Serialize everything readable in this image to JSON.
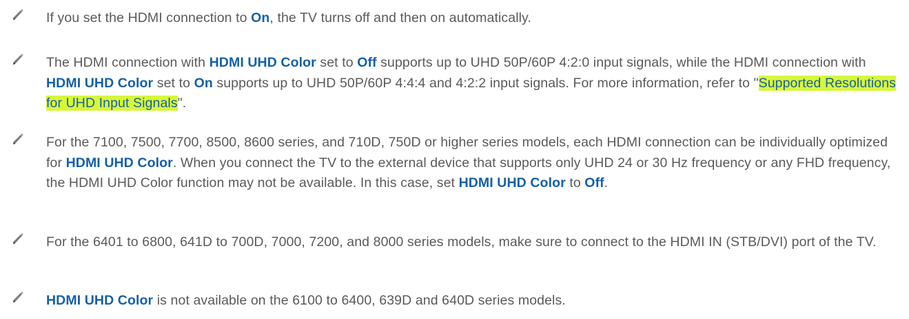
{
  "notes": [
    {
      "segments": [
        {
          "t": "If you set the HDMI connection to "
        },
        {
          "t": "On",
          "kw": true
        },
        {
          "t": ", the TV turns off and then on automatically."
        }
      ]
    },
    {
      "segments": [
        {
          "t": "The HDMI connection with "
        },
        {
          "t": "HDMI UHD Color",
          "kw": true
        },
        {
          "t": " set to "
        },
        {
          "t": "Off",
          "kw": true
        },
        {
          "t": " supports up to UHD 50P/60P 4:2:0 input signals, while the HDMI connection with "
        },
        {
          "t": "HDMI UHD Color",
          "kw": true
        },
        {
          "t": " set to "
        },
        {
          "t": "On",
          "kw": true
        },
        {
          "t": " supports up to UHD 50P/60P 4:4:4 and 4:2:2 input signals. For more information, refer to \""
        },
        {
          "t": "Supported Resolutions for UHD Input Signals",
          "link": true
        },
        {
          "t": "\"."
        }
      ]
    },
    {
      "segments": [
        {
          "t": "For the 7100, 7500, 7700, 8500, 8600 series, and 710D, 750D or higher series models, each HDMI connection can be individually optimized for "
        },
        {
          "t": "HDMI UHD Color",
          "kw": true
        },
        {
          "t": ". When you connect the TV to the external device that supports only UHD 24 or 30 Hz frequency or any FHD frequency, the HDMI UHD Color function may not be available. In this case, set "
        },
        {
          "t": "HDMI UHD Color",
          "kw": true
        },
        {
          "t": " to "
        },
        {
          "t": "Off",
          "kw": true
        },
        {
          "t": "."
        }
      ]
    },
    {
      "segments": [
        {
          "t": "For the 6401 to 6800, 641D to 700D, 7000, 7200, and 8000 series models, make sure to connect to the HDMI IN (STB/DVI) port of the TV."
        }
      ]
    },
    {
      "segments": [
        {
          "t": "HDMI UHD Color",
          "kw": true
        },
        {
          "t": " is not available on the 6100 to 6400, 639D and 640D series models."
        }
      ]
    }
  ],
  "colors": {
    "text": "#5a5a5a",
    "keyword": "#1560a8",
    "highlight": "#d7f73a"
  },
  "icon": "pencil-note-icon"
}
